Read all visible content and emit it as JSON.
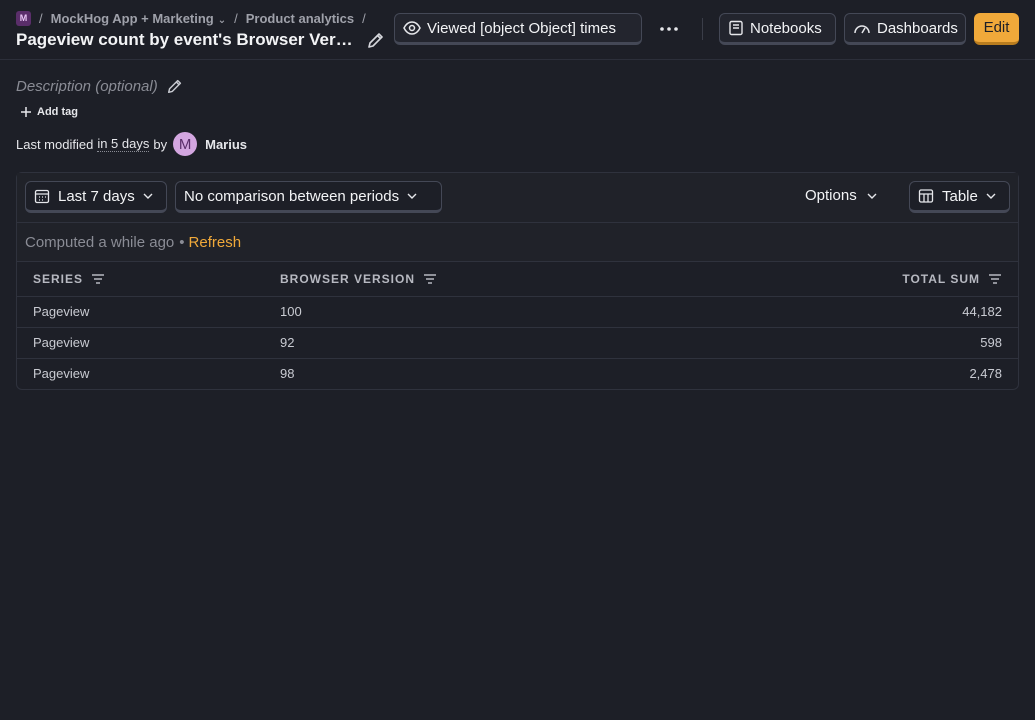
{
  "breadcrumb": {
    "project_badge": "M",
    "separator": "/",
    "project": "MockHog App + Marketing",
    "section": "Product analytics"
  },
  "header": {
    "title": "Pageview count by event's Browser Version",
    "views_label": "Viewed [object Object] times",
    "notebooks_label": "Notebooks",
    "dashboards_label": "Dashboards",
    "edit_label": "Edit"
  },
  "meta": {
    "description_placeholder": "Description (optional)",
    "add_tag_label": "Add tag",
    "modified_prefix": "Last modified",
    "modified_relative": "in 5 days",
    "modified_by": "by",
    "author_initial": "M",
    "author_name": "Marius"
  },
  "filters": {
    "date_range": "Last 7 days",
    "comparison": "No comparison between periods",
    "options_label": "Options",
    "display_type": "Table"
  },
  "status": {
    "computed_text": "Computed a while ago",
    "bullet": "•",
    "refresh_label": "Refresh"
  },
  "table": {
    "columns": [
      "SERIES",
      "BROWSER VERSION",
      "TOTAL SUM"
    ],
    "rows": [
      {
        "series": "Pageview",
        "version": "100",
        "total": "44,182"
      },
      {
        "series": "Pageview",
        "version": "92",
        "total": "598"
      },
      {
        "series": "Pageview",
        "version": "98",
        "total": "2,478"
      }
    ]
  },
  "colors": {
    "background": "#1d1f27",
    "accent": "#f0a93a",
    "avatar": "#d3a6e0"
  }
}
